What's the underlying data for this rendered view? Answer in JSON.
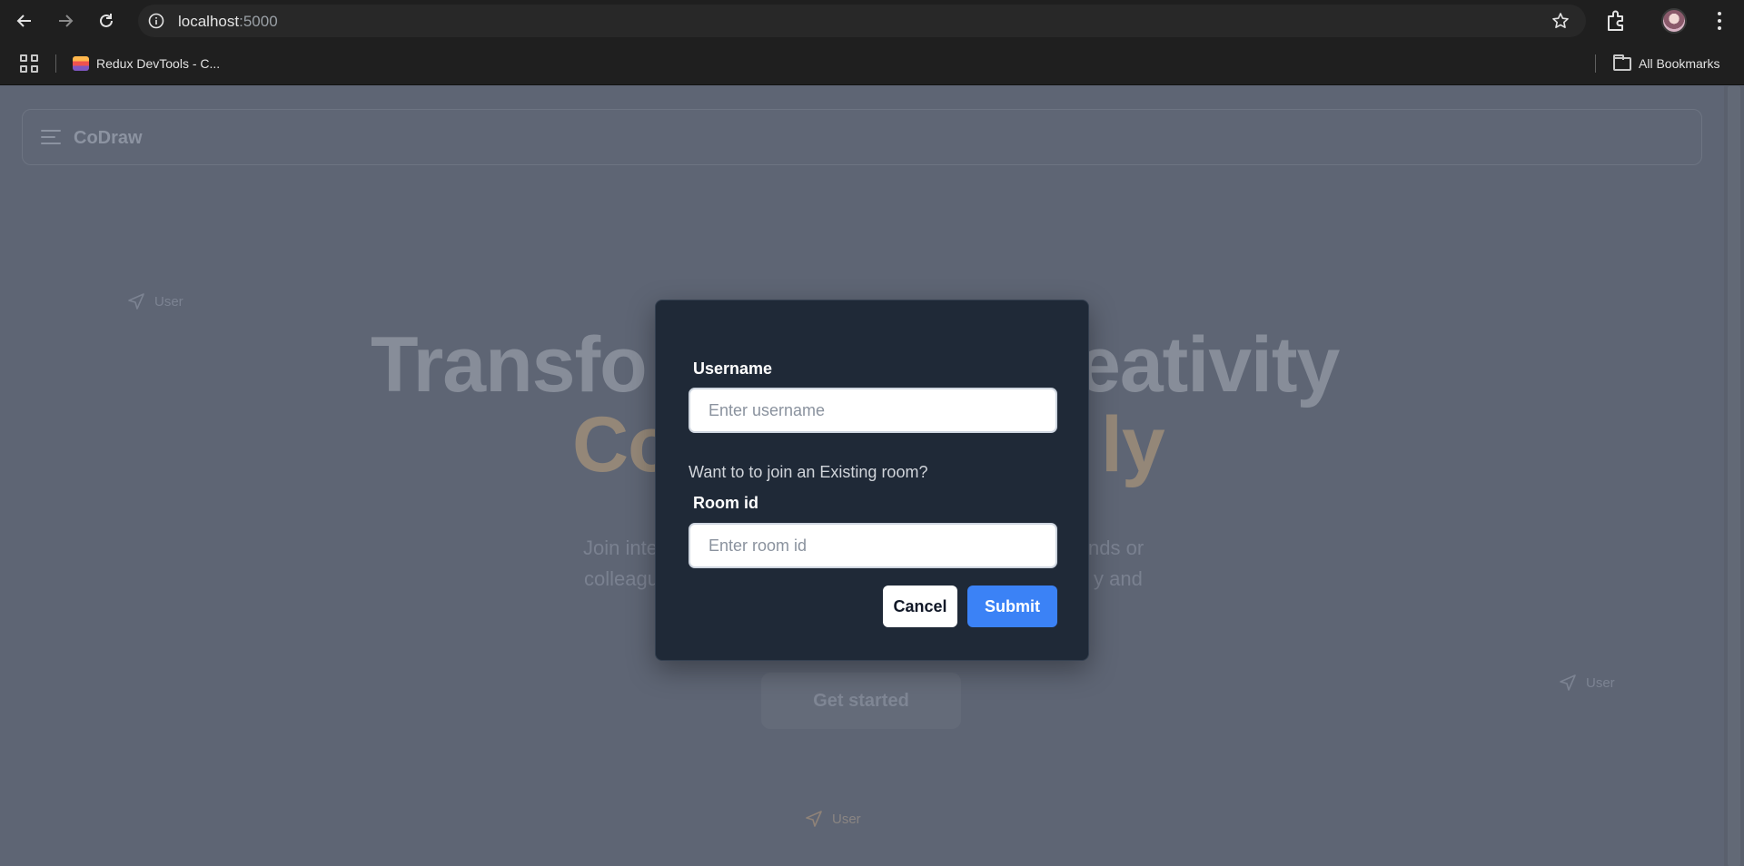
{
  "browser": {
    "url_host": "localhost",
    "url_port": ":5000",
    "bookmarks": [
      {
        "label": "Redux DevTools - C..."
      }
    ],
    "all_bookmarks_label": "All Bookmarks",
    "icons": {
      "back": "back-arrow-icon",
      "forward": "forward-arrow-icon",
      "reload": "reload-icon",
      "info": "info-icon",
      "star": "bookmark-star-icon",
      "extensions": "puzzle-icon",
      "menu": "kebab-menu-icon",
      "apps": "apps-grid-icon",
      "folder": "folder-icon"
    }
  },
  "page": {
    "navbar": {
      "brand": "CoDraw",
      "menu_icon": "hamburger-icon"
    },
    "hero": {
      "title_line1_left": "Transfo",
      "title_line1_right": "eativity",
      "title_line2_left": "Co",
      "title_line2_right": "ly",
      "subtitle_line1_left": "Join inte",
      "subtitle_line1_right": "nds or",
      "subtitle_line2_left": "colleagu",
      "subtitle_line2_right": "y and",
      "cta_label": "Get started"
    },
    "cursors": [
      {
        "label": "User",
        "icon": "send-icon"
      },
      {
        "label": "User",
        "icon": "send-icon"
      },
      {
        "label": "User",
        "icon": "send-icon"
      }
    ]
  },
  "modal": {
    "username_label": "Username",
    "username_placeholder": "Enter username",
    "username_value": "",
    "question": "Want to to join an Existing room?",
    "room_label": "Room id",
    "room_placeholder": "Enter room id",
    "room_value": "",
    "cancel_label": "Cancel",
    "submit_label": "Submit"
  },
  "colors": {
    "overlay_bg": "#5e6574",
    "modal_bg": "#1f2937",
    "submit_bg": "#3b82f6",
    "chrome_bg": "#1f1f1f"
  }
}
